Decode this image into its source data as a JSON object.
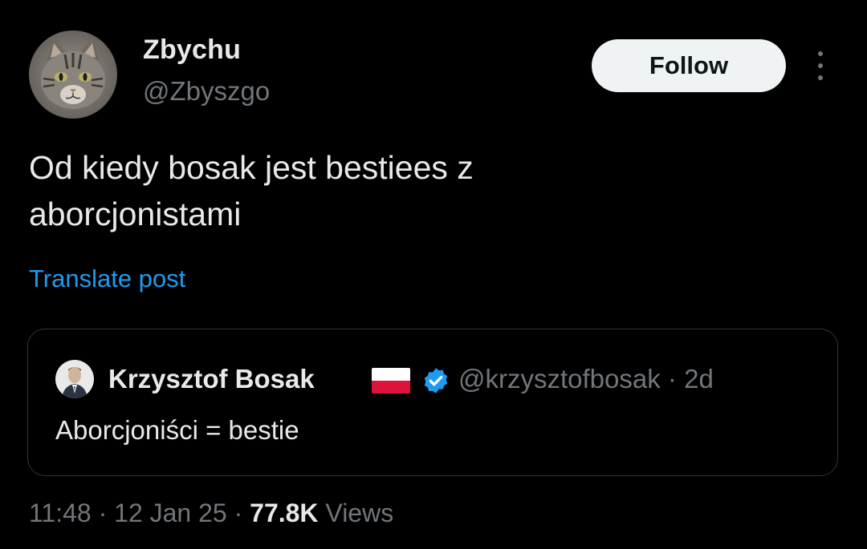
{
  "author": {
    "display_name": "Zbychu",
    "handle": "@Zbyszgo",
    "avatar_icon": "cat-avatar-icon"
  },
  "actions": {
    "follow_label": "Follow",
    "more_icon": "more-vertical-icon"
  },
  "tweet": {
    "text_line1": "Od kiedy bosak jest bestiees z",
    "text_line2": "aborcjonistami",
    "translate_label": "Translate post"
  },
  "quoted": {
    "display_name": "Krzysztof Bosak",
    "flag_icon": "poland-flag-icon",
    "verified_icon": "verified-badge-icon",
    "handle": "@krzysztofbosak",
    "separator": "·",
    "age": "2d",
    "text": "Aborcjoniści = bestie"
  },
  "meta": {
    "time": "11:48",
    "date": "12 Jan 25",
    "views_count": "77.8K",
    "views_label": "Views",
    "separator": "·"
  },
  "colors": {
    "background": "#000000",
    "text_primary": "#e7e9ea",
    "text_secondary": "#71767b",
    "link": "#1d9bf0",
    "verified": "#1d9bf0",
    "border": "#2f3336",
    "follow_bg": "#eff3f4"
  }
}
